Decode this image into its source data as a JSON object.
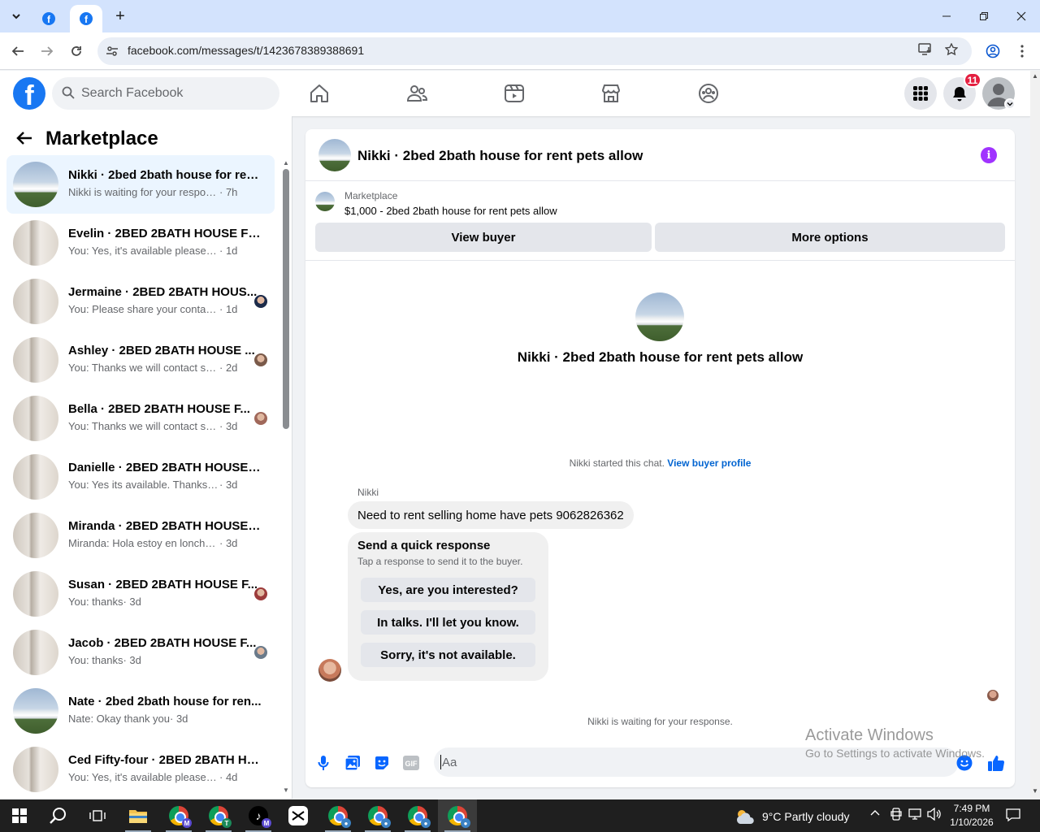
{
  "browser": {
    "tabs": [
      {
        "label": "Facebook"
      },
      {
        "label": "Facebook",
        "active": true
      }
    ],
    "new_tab": "+",
    "url": "facebook.com/messages/t/1423678389388691",
    "controls": {
      "minimize": "—",
      "maximize": "❐",
      "close": "✕"
    }
  },
  "facebook": {
    "search_placeholder": "Search Facebook",
    "notifications_badge": "11"
  },
  "sidebar": {
    "title": "Marketplace",
    "conversations": [
      {
        "title": "Nikki · 2bed 2bath house for ren...",
        "snippet": "Nikki is waiting for your response.",
        "time": "· 7h",
        "photo": "house",
        "active": true
      },
      {
        "title": "Evelin · 2BED 2BATH HOUSE FO...",
        "snippet": "You: Yes, it's available please drop y...",
        "time": "· 1d",
        "photo": "room"
      },
      {
        "title": "Jermaine · 2BED 2BATH HOUS...",
        "snippet": "You: Please share your contact n...",
        "time": "· 1d",
        "photo": "room",
        "mini": "#1c2b4a"
      },
      {
        "title": "Ashley · 2BED 2BATH HOUSE ...",
        "snippet": "You: Thanks we will contact soo...",
        "time": "· 2d",
        "photo": "room",
        "mini": "#7a5a4a"
      },
      {
        "title": "Bella · 2BED 2BATH HOUSE F...",
        "snippet": "You: Thanks we will contact soo...",
        "time": "· 3d",
        "photo": "room",
        "mini": "#a0685a"
      },
      {
        "title": "Danielle · 2BED 2BATH HOUSE F...",
        "snippet": "You: Yes its available. Thanks for rea...",
        "time": "· 3d",
        "photo": "room"
      },
      {
        "title": "Miranda · 2BED 2BATH HOUSE F...",
        "snippet": "Miranda: Hola estoy en lonche pod...",
        "time": "· 3d",
        "photo": "room"
      },
      {
        "title": "Susan · 2BED 2BATH HOUSE F...",
        "snippet": "You: thanks",
        "time": "· 3d",
        "photo": "room",
        "mini": "#9c3b3b"
      },
      {
        "title": "Jacob · 2BED 2BATH HOUSE F...",
        "snippet": "You: thanks",
        "time": "· 3d",
        "photo": "room",
        "mini": "#6a7a8a"
      },
      {
        "title": "Nate · 2bed 2bath house for ren...",
        "snippet": "Nate: Okay thank you",
        "time": "· 3d",
        "photo": "house"
      },
      {
        "title": "Ced Fifty-four · 2BED 2BATH HO...",
        "snippet": "You: Yes, it's available please drop y...",
        "time": "· 4d",
        "photo": "room"
      }
    ]
  },
  "chat": {
    "header_title": "Nikki · 2bed 2bath house for rent pets allow",
    "listing": {
      "label": "Marketplace",
      "title": "$1,000 - 2bed 2bath house for rent pets allow",
      "view_buyer": "View buyer",
      "more_options": "More options"
    },
    "hero_title": "Nikki · 2bed 2bath house for rent pets allow",
    "started_text": "Nikki started this chat.",
    "started_link": "View buyer profile",
    "sender": "Nikki",
    "message": "Need to rent selling home have pets 9062826362",
    "quick": {
      "title": "Send a quick response",
      "subtitle": "Tap a response to send it to the buyer.",
      "options": [
        "Yes, are you interested?",
        "In talks. I'll let you know.",
        "Sorry, it's not available."
      ]
    },
    "waiting": "Nikki is waiting for your response.",
    "composer_placeholder": "Aa"
  },
  "watermark": {
    "line1": "Activate Windows",
    "line2": "Go to Settings to activate Windows."
  },
  "taskbar": {
    "weather": "9°C  Partly cloudy",
    "time": "7:49 PM",
    "date": "1/10/2026"
  }
}
